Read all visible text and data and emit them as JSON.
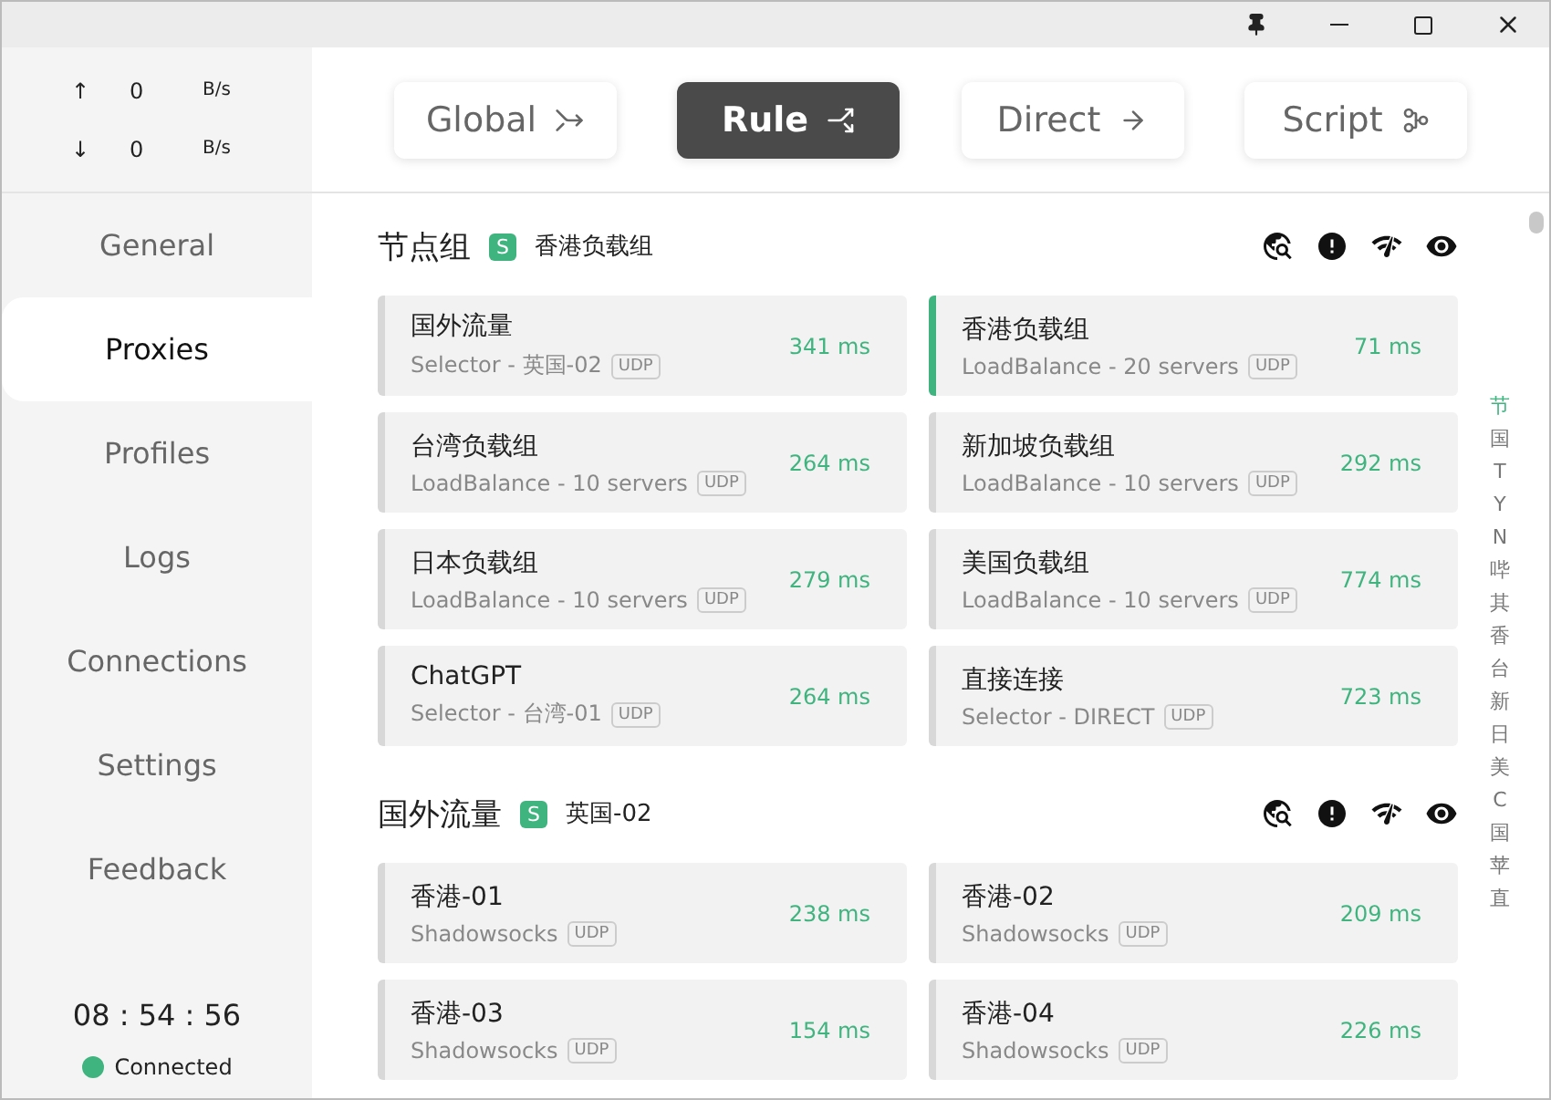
{
  "traffic": [
    {
      "arrow": "↑",
      "value": "0",
      "unit": "B/s"
    },
    {
      "arrow": "↓",
      "value": "0",
      "unit": "B/s"
    }
  ],
  "nav": [
    {
      "label": "General",
      "selected": false
    },
    {
      "label": "Proxies",
      "selected": true
    },
    {
      "label": "Profiles",
      "selected": false
    },
    {
      "label": "Logs",
      "selected": false
    },
    {
      "label": "Connections",
      "selected": false
    },
    {
      "label": "Settings",
      "selected": false
    },
    {
      "label": "Feedback",
      "selected": false
    }
  ],
  "clock": "08 : 54 : 56",
  "status": {
    "label": "Connected",
    "color": "#3fb47f"
  },
  "modes": [
    {
      "label": "Global",
      "kind": "merge",
      "selected": false
    },
    {
      "label": "Rule",
      "kind": "split",
      "selected": true
    },
    {
      "label": "Direct",
      "kind": "arrow",
      "selected": false
    },
    {
      "label": "Script",
      "kind": "fork",
      "selected": false
    }
  ],
  "groups": [
    {
      "name": "节点组",
      "badge": "S",
      "current": "香港负载组",
      "proxies": [
        {
          "name": "国外流量",
          "detail": "Selector - 英国-02",
          "tag": "UDP",
          "delay": "341 ms",
          "selected": false
        },
        {
          "name": "香港负载组",
          "detail": "LoadBalance - 20 servers",
          "tag": "UDP",
          "delay": "71 ms",
          "selected": true
        },
        {
          "name": "台湾负载组",
          "detail": "LoadBalance - 10 servers",
          "tag": "UDP",
          "delay": "264 ms",
          "selected": false
        },
        {
          "name": "新加坡负载组",
          "detail": "LoadBalance - 10 servers",
          "tag": "UDP",
          "delay": "292 ms",
          "selected": false
        },
        {
          "name": "日本负载组",
          "detail": "LoadBalance - 10 servers",
          "tag": "UDP",
          "delay": "279 ms",
          "selected": false
        },
        {
          "name": "美国负载组",
          "detail": "LoadBalance - 10 servers",
          "tag": "UDP",
          "delay": "774 ms",
          "selected": false
        },
        {
          "name": "ChatGPT",
          "detail": "Selector - 台湾-01",
          "tag": "UDP",
          "delay": "264 ms",
          "selected": false
        },
        {
          "name": "直接连接",
          "detail": "Selector - DIRECT",
          "tag": "UDP",
          "delay": "723 ms",
          "selected": false
        }
      ]
    },
    {
      "name": "国外流量",
      "badge": "S",
      "current": "英国-02",
      "proxies": [
        {
          "name": "香港-01",
          "detail": "Shadowsocks",
          "tag": "UDP",
          "delay": "238 ms",
          "selected": false
        },
        {
          "name": "香港-02",
          "detail": "Shadowsocks",
          "tag": "UDP",
          "delay": "209 ms",
          "selected": false
        },
        {
          "name": "香港-03",
          "detail": "Shadowsocks",
          "tag": "UDP",
          "delay": "154 ms",
          "selected": false
        },
        {
          "name": "香港-04",
          "detail": "Shadowsocks",
          "tag": "UDP",
          "delay": "226 ms",
          "selected": false
        }
      ]
    }
  ],
  "index": [
    {
      "label": "节",
      "selected": true
    },
    {
      "label": "国",
      "selected": false
    },
    {
      "label": "T",
      "selected": false
    },
    {
      "label": "Y",
      "selected": false
    },
    {
      "label": "N",
      "selected": false
    },
    {
      "label": "哔",
      "selected": false
    },
    {
      "label": "其",
      "selected": false
    },
    {
      "label": "香",
      "selected": false
    },
    {
      "label": "台",
      "selected": false
    },
    {
      "label": "新",
      "selected": false
    },
    {
      "label": "日",
      "selected": false
    },
    {
      "label": "美",
      "selected": false
    },
    {
      "label": "C",
      "selected": false
    },
    {
      "label": "国",
      "selected": false
    },
    {
      "label": "苹",
      "selected": false
    },
    {
      "label": "直",
      "selected": false
    }
  ]
}
